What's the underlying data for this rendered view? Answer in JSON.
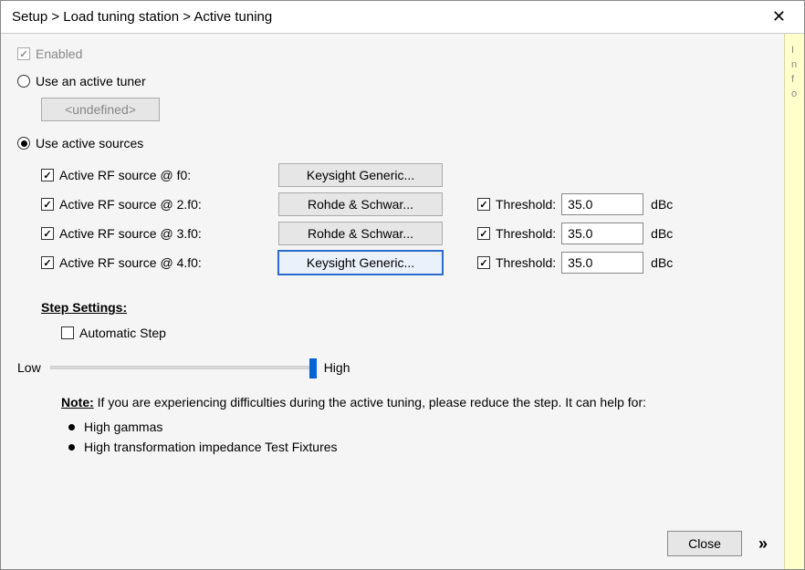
{
  "title": "Setup > Load tuning station > Active tuning",
  "close_x": "✕",
  "info_label": "Info",
  "enabled": {
    "label": "Enabled",
    "checked": true,
    "disabled": true
  },
  "mode": {
    "active_tuner": {
      "label": "Use an active tuner",
      "selected": false,
      "button_label": "<undefined>"
    },
    "active_sources": {
      "label": "Use active sources",
      "selected": true
    }
  },
  "sources": [
    {
      "enabled": true,
      "label": "Active RF source @ f0:",
      "device_btn": "Keysight Generic...",
      "focused": false,
      "threshold": null
    },
    {
      "enabled": true,
      "label": "Active RF source @ 2.f0:",
      "device_btn": "Rohde & Schwar...",
      "focused": false,
      "threshold": {
        "enabled": true,
        "label": "Threshold:",
        "value": "35.0",
        "unit": "dBc"
      }
    },
    {
      "enabled": true,
      "label": "Active RF source @ 3.f0:",
      "device_btn": "Rohde & Schwar...",
      "focused": false,
      "threshold": {
        "enabled": true,
        "label": "Threshold:",
        "value": "35.0",
        "unit": "dBc"
      }
    },
    {
      "enabled": true,
      "label": "Active RF source @ 4.f0:",
      "device_btn": "Keysight Generic...",
      "focused": true,
      "threshold": {
        "enabled": true,
        "label": "Threshold:",
        "value": "35.0",
        "unit": "dBc"
      }
    }
  ],
  "step": {
    "header": "Step Settings:",
    "auto": {
      "label": "Automatic Step",
      "checked": false
    },
    "slider": {
      "low_label": "Low",
      "high_label": "High",
      "position_pct": 100
    },
    "note_label": "Note:",
    "note_text": "If you are experiencing difficulties during the active tuning, please reduce the step. It can help for:",
    "bullets": [
      "High gammas",
      "High transformation impedance Test Fixtures"
    ]
  },
  "footer": {
    "close_label": "Close",
    "expand_glyph": "»"
  }
}
